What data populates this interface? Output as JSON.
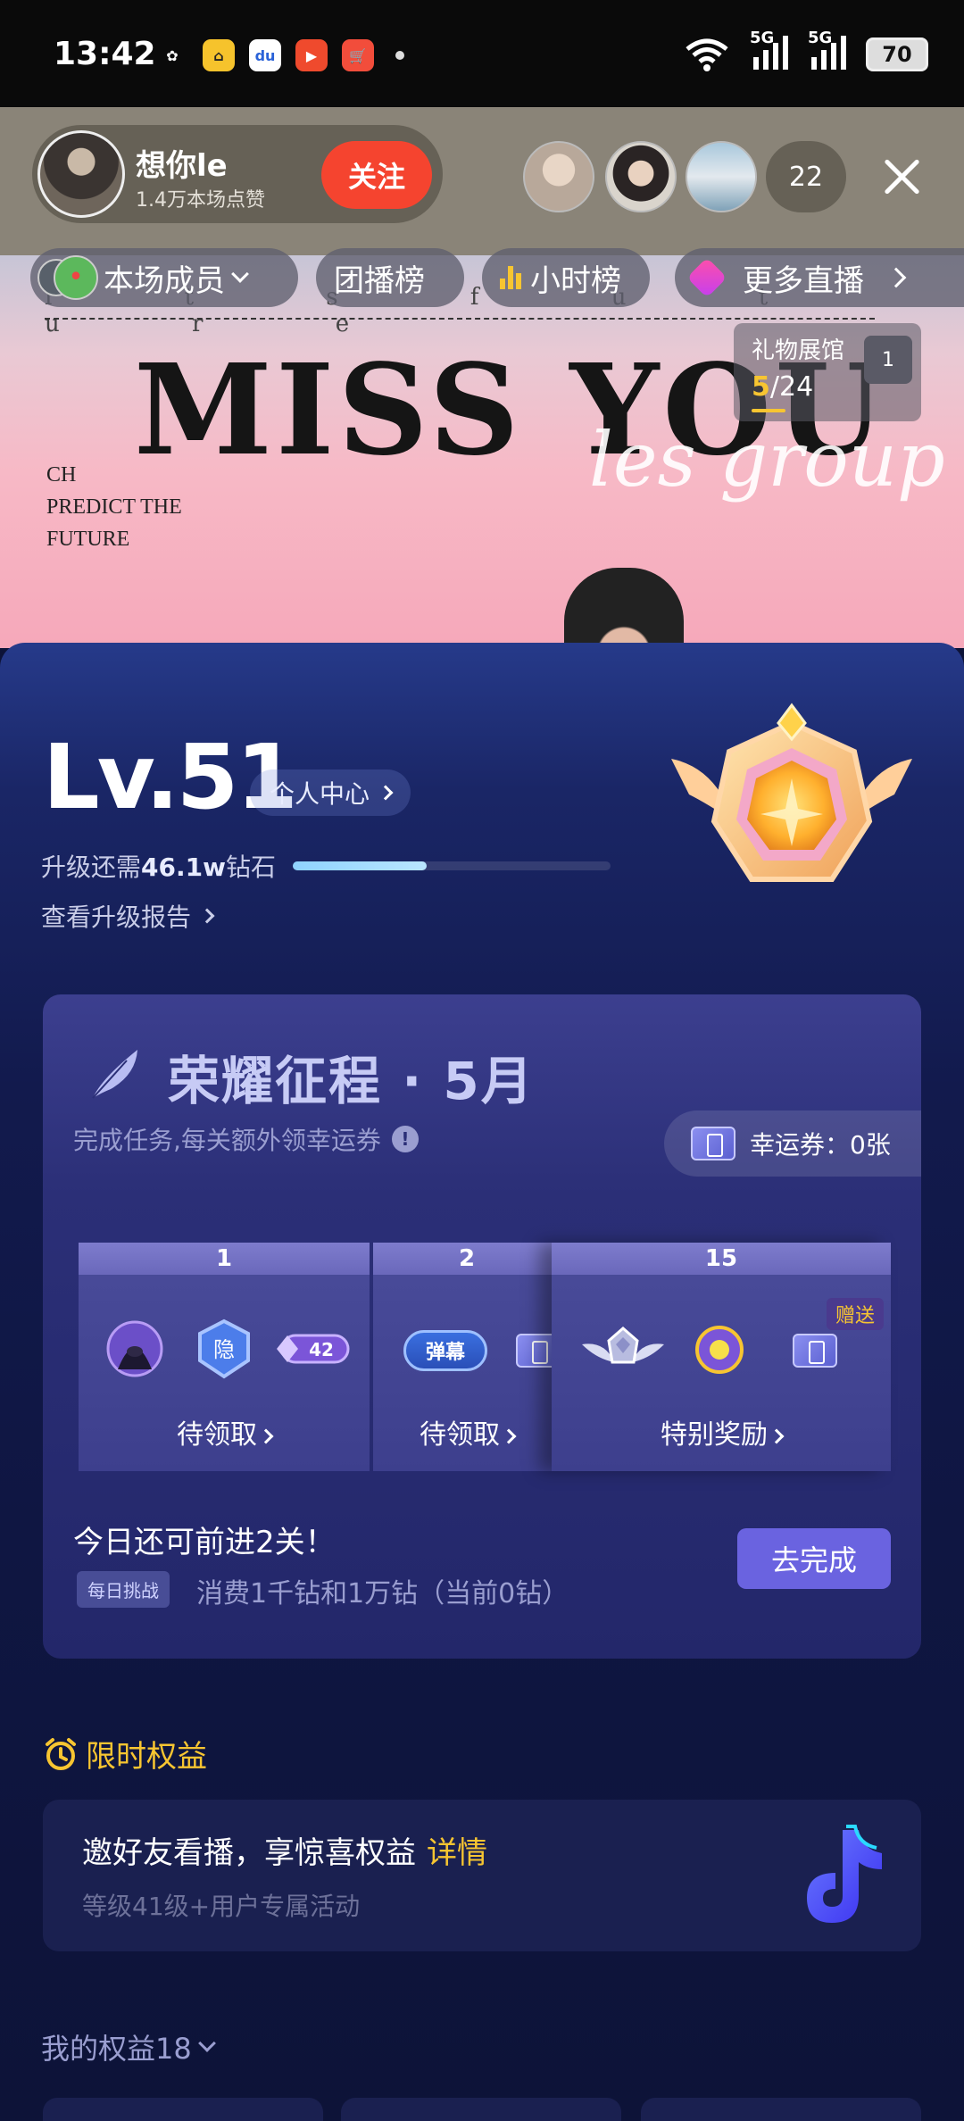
{
  "status_bar": {
    "time": "13:42",
    "apps": [
      {
        "icon": "wechat-icon",
        "glyph": "✿",
        "bg": "#0a0a0a",
        "fg": "#ffffff"
      },
      {
        "icon": "qingju-icon",
        "glyph": "⌂",
        "bg": "#f6c32c",
        "fg": "#222222"
      },
      {
        "icon": "baidu-icon",
        "glyph": "du",
        "bg": "#ffffff",
        "fg": "#2a62d8"
      },
      {
        "icon": "video-icon",
        "glyph": "▶",
        "bg": "#ef4a2d",
        "fg": "#ffffff"
      },
      {
        "icon": "shopping-icon",
        "glyph": "🛒",
        "bg": "#f24d3b",
        "fg": "#ffffff"
      }
    ],
    "signal_1": "5G",
    "signal_2": "5G",
    "battery": "70"
  },
  "live_header": {
    "anchor_name": "想你le",
    "anchor_likes": "1.4万本场点赞",
    "follow_label": "关注",
    "viewer_count": "22"
  },
  "subnav": {
    "members": "本场成员",
    "team_rank": "团播榜",
    "hour_rank": "小时榜",
    "more_live": "更多直播"
  },
  "stream": {
    "headline": "MISS YOU",
    "script_text": "les group",
    "tagline_lines": [
      "CH",
      "PREDICT THE",
      "FUTURE"
    ],
    "ghost_letters": "i t s f u t u r e",
    "gift_hall_title": "礼物展馆",
    "gift_hall_current": "5",
    "gift_hall_total": "/24",
    "gift_thumb_badge": "1"
  },
  "level": {
    "level_text": "Lv.51",
    "center_label": "个人中心",
    "upgrade_prefix": "升级还需",
    "upgrade_amount": "46.1w",
    "upgrade_suffix": "钻石",
    "progress": 0.42,
    "report_label": "查看升级报告"
  },
  "honor": {
    "title": "荣耀征程 · 5月",
    "subtitle": "完成任务,每关额外领幸运券",
    "lucky_label": "幸运券：0张",
    "stages": [
      {
        "num": "1",
        "label": "待领取",
        "icons": [
          "hood-avatar-icon",
          "hidden-shield-icon",
          "gem-42-icon"
        ],
        "gem_value": "42"
      },
      {
        "num": "2",
        "label": "待领取",
        "icons": [
          "danmu-badge-icon",
          "ticket-icon"
        ],
        "badge_text": "弹幕"
      },
      {
        "num": "15",
        "label": "特别奖励",
        "icons": [
          "winged-crest-icon",
          "purple-orb-icon",
          "ticket-icon"
        ],
        "tag": "赠送"
      }
    ],
    "today_text": "今日还可前进2关！",
    "daily_tag": "每日挑战",
    "daily_text": "消费1千钻和1万钻（当前0钻）",
    "go_button": "去完成"
  },
  "limited": {
    "title": "限时权益",
    "invite_title": "邀好友看播，享惊喜权益",
    "invite_detail": "详情",
    "invite_sub": "等级41级+用户专属活动"
  },
  "my_benefits": "我的权益18",
  "colors": {
    "accent_gold": "#f7c531",
    "follow_red": "#f5442f",
    "button_purple": "#6a63e0",
    "panel_navy": "#0f1642"
  }
}
